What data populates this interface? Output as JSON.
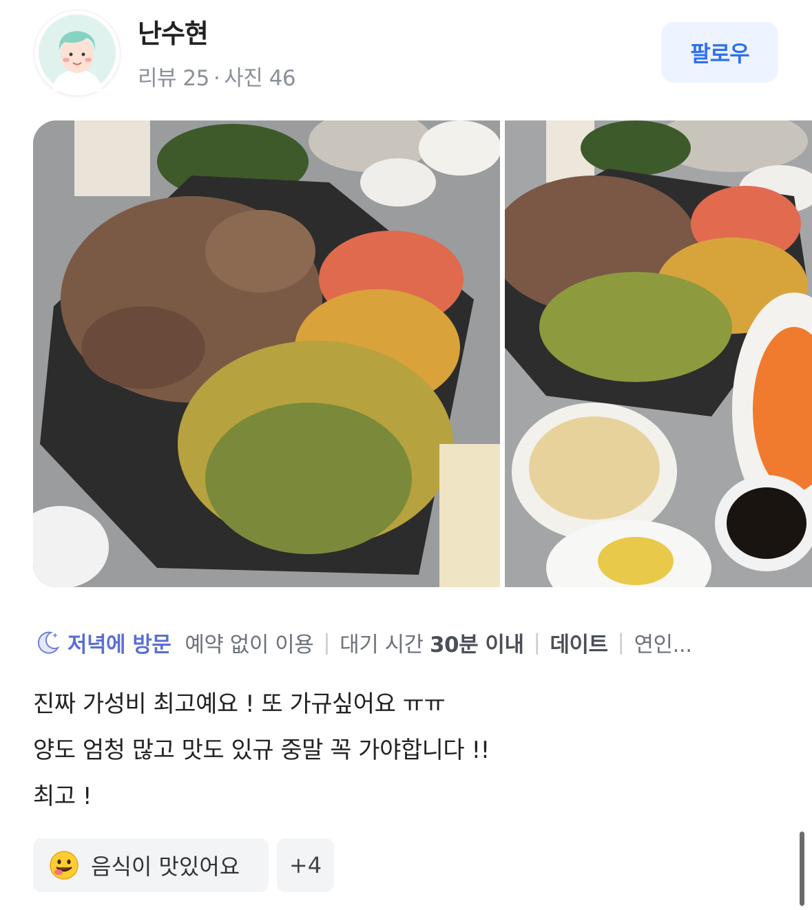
{
  "user": {
    "name": "난수현",
    "reviews_label": "리뷰 25",
    "dot": "·",
    "photos_label": "사진 46"
  },
  "follow_label": "팔로우",
  "photos": [
    {
      "alt": "grilled pork, kimchi, bean sprouts and scallion salad on iron plate"
    },
    {
      "alt": "grill plate with side dishes of pickled radish, corn and carrots"
    }
  ],
  "visit": {
    "time_label": "저녁에 방문",
    "tags": [
      {
        "prefix": "예약 없이 이용",
        "bold": ""
      },
      {
        "prefix": "대기 시간 ",
        "bold": "30분 이내"
      },
      {
        "prefix": "",
        "bold": "데이트"
      },
      {
        "prefix": "연인...",
        "bold": ""
      }
    ],
    "separator": "|"
  },
  "review_lines": [
    "진짜 가성비 최고예요 ! 또 가규싶어요 ㅠㅠ",
    "양도 엄청 많고 맛도 있규 중말 꼭 가야합니다 !!",
    "최고 !"
  ],
  "keywords": {
    "first": "음식이 맛있어요",
    "more": "+4"
  },
  "icons": {
    "avatar": "avatar-icon",
    "moon": "moon-icon",
    "smiley": "smiley-face-icon"
  },
  "colors": {
    "follow_bg": "#eef4ff",
    "follow_text": "#2e6ff2",
    "visit_time": "#5b6fd2",
    "chip_bg": "#f3f4f6"
  }
}
